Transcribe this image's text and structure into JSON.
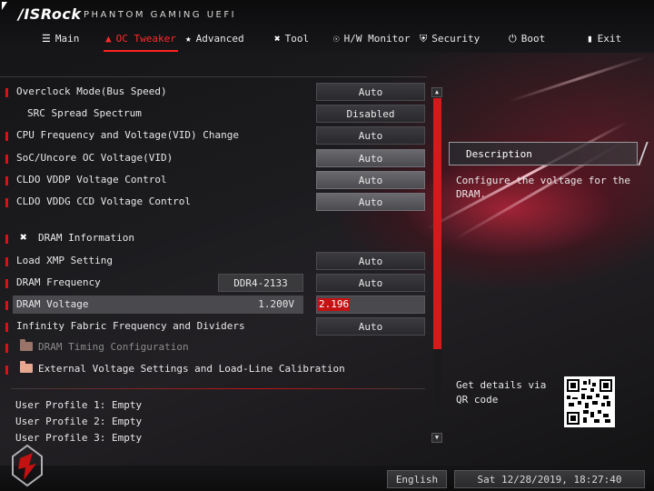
{
  "header": {
    "brand": "/ISRock",
    "subbrand": "PHANTOM GAMING UEFI"
  },
  "tabs": [
    {
      "label": "Main",
      "icon": "list-icon"
    },
    {
      "label": "OC Tweaker",
      "icon": "flame-icon",
      "active": true
    },
    {
      "label": "Advanced",
      "icon": "star-icon"
    },
    {
      "label": "Tool",
      "icon": "tool-icon"
    },
    {
      "label": "H/W Monitor",
      "icon": "monitor-icon"
    },
    {
      "label": "Security",
      "icon": "shield-icon"
    },
    {
      "label": "Boot",
      "icon": "power-icon"
    },
    {
      "label": "Exit",
      "icon": "exit-icon"
    }
  ],
  "settings": {
    "overclock_mode": {
      "label": "Overclock Mode(Bus Speed)",
      "value": "Auto"
    },
    "src_spread": {
      "label": "SRC Spread Spectrum",
      "value": "Disabled"
    },
    "cpu_freq": {
      "label": "CPU Frequency and Voltage(VID) Change",
      "value": "Auto"
    },
    "soc_oc": {
      "label": "SoC/Uncore OC Voltage(VID)",
      "value": "Auto"
    },
    "cldo_vddp": {
      "label": "CLDO VDDP Voltage Control",
      "value": "Auto"
    },
    "cldo_vddg": {
      "label": "CLDO VDDG CCD Voltage Control",
      "value": "Auto"
    },
    "dram_info": {
      "label": "DRAM Information"
    },
    "load_xmp": {
      "label": "Load XMP Setting",
      "value": "Auto"
    },
    "dram_freq": {
      "label": "DRAM Frequency",
      "info": "DDR4-2133",
      "value": "Auto"
    },
    "dram_voltage": {
      "label": "DRAM Voltage",
      "current": "1.200V",
      "value": "2.196"
    },
    "infinity_fabric": {
      "label": "Infinity Fabric Frequency and Dividers",
      "value": "Auto"
    },
    "dram_timing": {
      "label": "DRAM Timing Configuration"
    },
    "ext_voltage": {
      "label": "External Voltage Settings and Load-Line Calibration"
    }
  },
  "profiles": [
    "User Profile 1: Empty",
    "User Profile 2: Empty",
    "User Profile 3: Empty"
  ],
  "description": {
    "title": "Description",
    "text": "Configure the voltage for the DRAM."
  },
  "qr": {
    "text": "Get details via QR code"
  },
  "footer": {
    "language": "English",
    "datetime": "Sat 12/28/2019, 18:27:40"
  },
  "colors": {
    "accent": "#d41a1a",
    "active_tab": "#ff2a2a",
    "edit_highlight": "#c41111"
  }
}
